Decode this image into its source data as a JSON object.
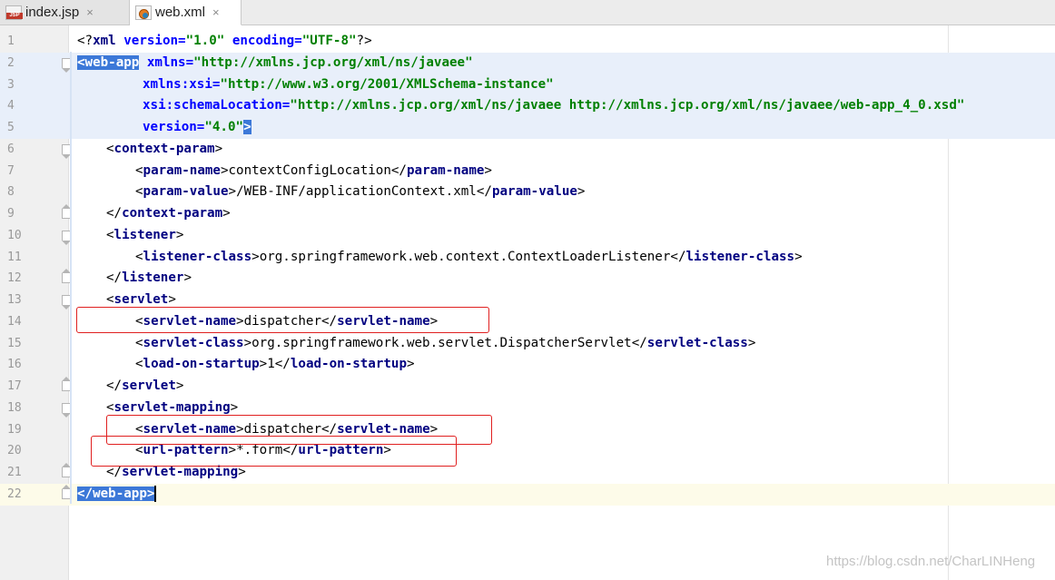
{
  "tabs": [
    {
      "label": "index.jsp",
      "icon": "jsp-file-icon",
      "active": false
    },
    {
      "label": "web.xml",
      "icon": "xml-file-icon",
      "active": true
    }
  ],
  "jsp_badge": "JSP",
  "close_glyph": "×",
  "line_numbers": [
    "1",
    "2",
    "3",
    "4",
    "5",
    "6",
    "7",
    "8",
    "9",
    "10",
    "11",
    "12",
    "13",
    "14",
    "15",
    "16",
    "17",
    "18",
    "19",
    "20",
    "21",
    "22"
  ],
  "code": {
    "l1_open": "<?",
    "l1_name": "xml",
    "l1_attr1": " version=",
    "l1_val1": "\"1.0\"",
    "l1_attr2": " encoding=",
    "l1_val2": "\"UTF-8\"",
    "l1_close": "?>",
    "web_app_open": "<web-app",
    "xmlns": " xmlns=",
    "xmlns_val": "\"http://xmlns.jcp.org/xml/ns/javaee\"",
    "xmlns_xsi": "xmlns:xsi=",
    "xmlns_xsi_val": "\"http://www.w3.org/2001/XMLSchema-instance\"",
    "schema_loc": "xsi:schemaLocation=",
    "schema_loc_val": "\"http://xmlns.jcp.org/xml/ns/javaee http://xmlns.jcp.org/xml/ns/javaee/web-app_4_0.xsd\"",
    "version": "version=",
    "version_val": "\"4.0\"",
    "gt": ">",
    "context_param": "context-param",
    "param_name": "param-name",
    "param_name_val": "contextConfigLocation",
    "param_value": "param-value",
    "param_value_val": "/WEB-INF/applicationContext.xml",
    "listener": "listener",
    "listener_class": "listener-class",
    "listener_class_val": "org.springframework.web.context.ContextLoaderListener",
    "servlet": "servlet",
    "servlet_name": "servlet-name",
    "servlet_name_val": "dispatcher",
    "servlet_class": "servlet-class",
    "servlet_class_val": "org.springframework.web.servlet.DispatcherServlet",
    "load_on_startup": "load-on-startup",
    "load_on_startup_val": "1",
    "servlet_mapping": "servlet-mapping",
    "url_pattern": "url-pattern",
    "url_pattern_val": "*.form",
    "web_app_close": "</web-app>"
  },
  "watermark": "https://blog.csdn.net/CharLINHeng",
  "colors": {
    "tag": "#000080",
    "attr": "#0000ff",
    "value": "#008000",
    "annotation": "#e02020",
    "selection": "#3c78d8"
  }
}
